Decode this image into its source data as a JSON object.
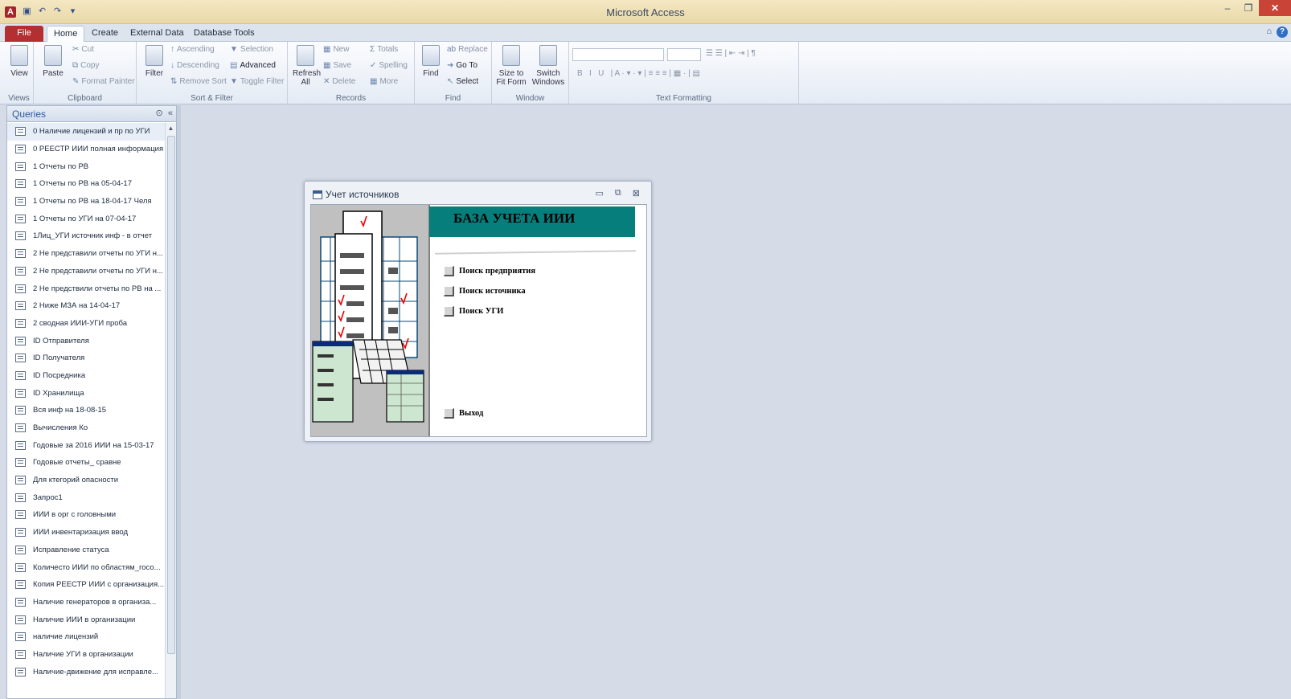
{
  "window": {
    "title": "Microsoft Access",
    "app_logo": "A"
  },
  "quick_access": [
    "save-icon",
    "undo-icon",
    "redo-icon",
    "customize-icon"
  ],
  "tabs": [
    {
      "label": "File"
    },
    {
      "label": "Home"
    },
    {
      "label": "Create"
    },
    {
      "label": "External Data"
    },
    {
      "label": "Database Tools"
    }
  ],
  "ribbon": {
    "views": {
      "label": "Views",
      "view": "View"
    },
    "clipboard": {
      "label": "Clipboard",
      "paste": "Paste",
      "cut": "Cut",
      "copy": "Copy",
      "format_painter": "Format Painter"
    },
    "sort_filter": {
      "label": "Sort & Filter",
      "filter": "Filter",
      "ascending": "Ascending",
      "descending": "Descending",
      "remove_sort": "Remove Sort",
      "selection": "Selection",
      "advanced": "Advanced",
      "toggle_filter": "Toggle Filter"
    },
    "records": {
      "label": "Records",
      "refresh": "Refresh",
      "refresh_sub": "All",
      "new": "New",
      "save": "Save",
      "delete": "Delete",
      "totals": "Totals",
      "spelling": "Spelling",
      "more": "More"
    },
    "find": {
      "label": "Find",
      "find": "Find",
      "replace": "Replace",
      "goto": "Go To",
      "select": "Select"
    },
    "window_group": {
      "label": "Window",
      "size_to": "Size to",
      "fit_form": "Fit Form",
      "switch": "Switch",
      "windows": "Windows"
    },
    "text_formatting": {
      "label": "Text Formatting"
    }
  },
  "nav": {
    "title": "Queries",
    "items": [
      "0 Наличие лицензий и пр по УГИ",
      "0 РЕЕСТР ИИИ полная информация",
      "1 Отчеты по РВ",
      "1 Отчеты по РВ на 05-04-17",
      "1 Отчеты по РВ на 18-04-17 Челя",
      "1 Отчеты по УГИ на 07-04-17",
      "1Лиц_УГИ источник инф - в отчет",
      "2 Не представили отчеты по УГИ н...",
      "2 Не представили отчеты по УГИ н...",
      "2 Не предствили отчеты по РВ на ...",
      "2 Ниже МЗА на 14-04-17",
      "2 сводная ИИИ-УГИ проба",
      "ID Отправителя",
      "ID Получателя",
      "ID Посредника",
      "ID Хранилища",
      "Вся инф на 18-08-15",
      "Вычисления Ко",
      "Годовые за 2016 ИИИ на 15-03-17",
      "Годовые отчеты_ сравне",
      "Для ктегорий опасности",
      "Запрос1",
      "ИИИ в орг с головными",
      "ИИИ инвентаризация ввод",
      "Исправление статуса",
      "Количесто ИИИ по областям_госо...",
      "Копия РЕЕСТР ИИИ с организация...",
      "Наличие генераторов в организа...",
      "Наличие ИИИ в организации",
      "наличие лицензий",
      "Наличие УГИ в организации",
      "Наличие-движение для исправле..."
    ]
  },
  "form": {
    "title": "Учет источников",
    "banner": "БАЗА УЧЕТА ИИИ",
    "options": [
      "Поиск предприятия",
      "Поиск источника",
      "Поиск УГИ"
    ],
    "exit": "Выход"
  }
}
